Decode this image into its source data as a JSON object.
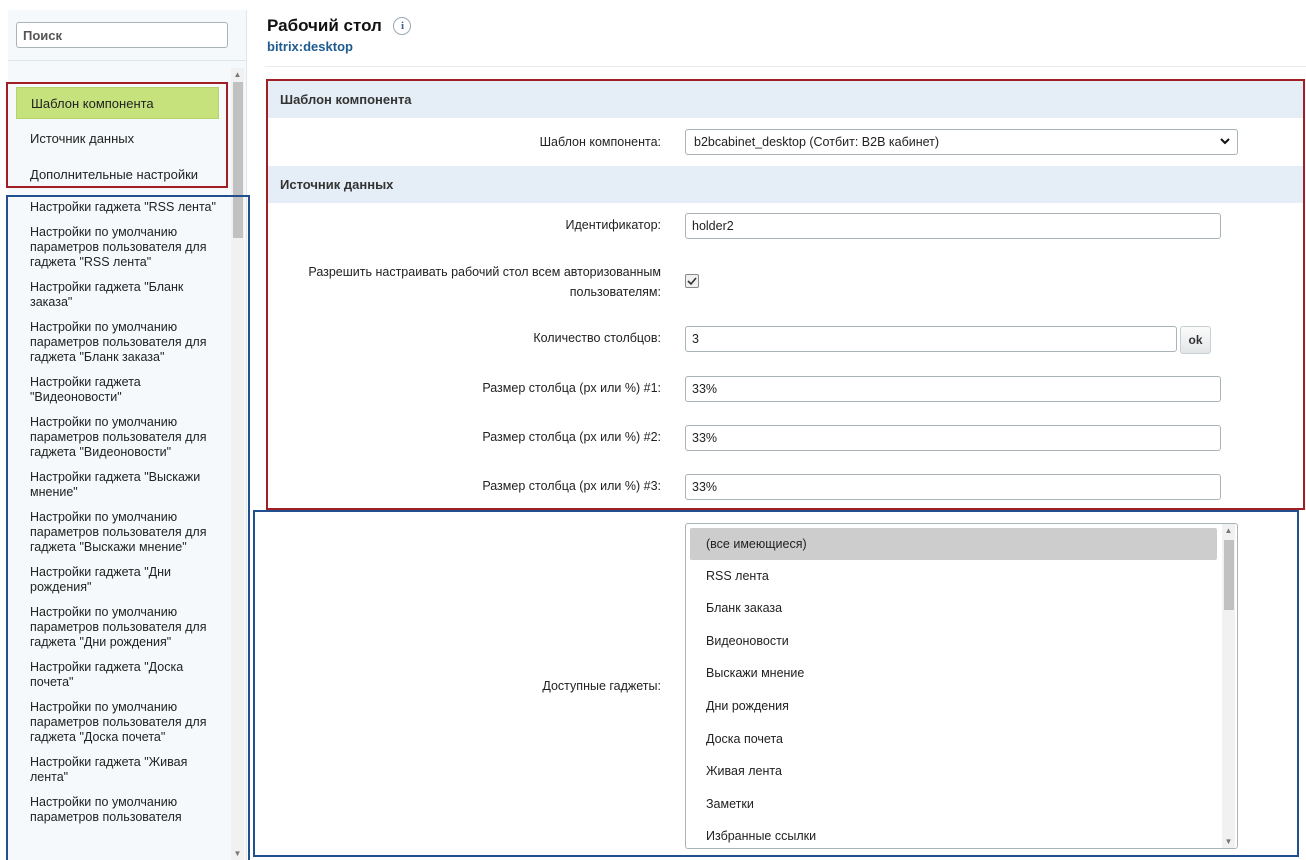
{
  "sidebar": {
    "search_placeholder": "Поиск",
    "sections": [
      "Шаблон компонента",
      "Источник данных",
      "Дополнительные настройки"
    ],
    "gadget_settings": [
      "Настройки гаджета \"RSS лента\"",
      "Настройки по умолчанию параметров пользователя для гаджета \"RSS лента\"",
      "Настройки гаджета \"Бланк заказа\"",
      "Настройки по умолчанию параметров пользователя для гаджета \"Бланк заказа\"",
      "Настройки гаджета \"Видеоновости\"",
      "Настройки по умолчанию параметров пользователя для гаджета \"Видеоновости\"",
      "Настройки гаджета \"Выскажи мнение\"",
      "Настройки по умолчанию параметров пользователя для гаджета \"Выскажи мнение\"",
      "Настройки гаджета \"Дни рождения\"",
      "Настройки по умолчанию параметров пользователя для гаджета \"Дни рождения\"",
      "Настройки гаджета \"Доска почета\"",
      "Настройки по умолчанию параметров пользователя для гаджета \"Доска почета\"",
      "Настройки гаджета \"Живая лента\"",
      "Настройки по умолчанию параметров пользователя"
    ]
  },
  "header": {
    "title": "Рабочий стол",
    "info_icon": "i",
    "code": "bitrix:desktop"
  },
  "form": {
    "section_template": "Шаблон компонента",
    "template_label": "Шаблон компонента:",
    "template_value": "b2bcabinet_desktop (Сотбит: B2B кабинет)",
    "section_source": "Источник данных",
    "id_label": "Идентификатор:",
    "id_value": "holder2",
    "allow_label_line1": "Разрешить настраивать рабочий стол всем авторизованным",
    "allow_label_line2": "пользователям:",
    "allow_checked": true,
    "columns_label": "Количество столбцов:",
    "columns_value": "3",
    "ok_label": "ok",
    "col1_label": "Размер столбца (px или %) #1:",
    "col1_value": "33%",
    "col2_label": "Размер столбца (px или %) #2:",
    "col2_value": "33%",
    "col3_label": "Размер столбца (px или %) #3:",
    "col3_value": "33%",
    "gadgets_label": "Доступные гаджеты:",
    "gadgets_options": [
      "(все имеющиеся)",
      "RSS лента",
      "Бланк заказа",
      "Видеоновости",
      "Выскажи мнение",
      "Дни рождения",
      "Доска почета",
      "Живая лента",
      "Заметки",
      "Избранные ссылки"
    ]
  }
}
